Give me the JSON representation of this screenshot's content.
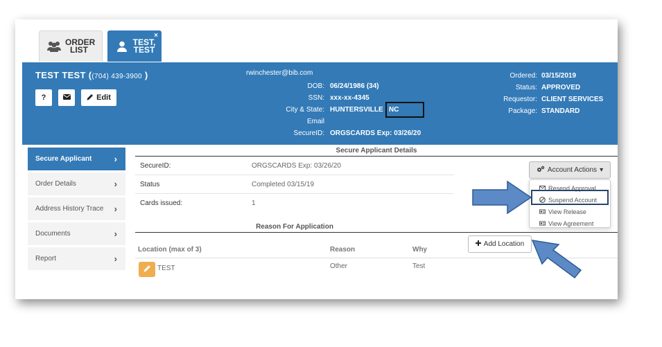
{
  "tabs": [
    {
      "label_line1": "ORDER",
      "label_line2": "LIST",
      "icon": "users-icon"
    },
    {
      "label_line1": "TEST,",
      "label_line2": "TEST",
      "icon": "user-icon",
      "close": "×"
    }
  ],
  "header": {
    "name": "TEST TEST",
    "phone_open": "(",
    "phone": "(704) 439-3900",
    "phone_close": ")",
    "buttons": {
      "help": "?",
      "email_icon": "envelope-icon",
      "edit": "Edit"
    },
    "email": "rwinchester@bib.com",
    "middle": [
      {
        "label": "DOB:",
        "value": "06/24/1986 (34)"
      },
      {
        "label": "SSN:",
        "value": "xxx-xx-4345"
      },
      {
        "label": "City & State:",
        "value": "HUNTERSVILLE , NC"
      },
      {
        "label": "Email",
        "value": ""
      },
      {
        "label": "SecureID:",
        "value": "ORGSCARDS Exp: 03/26/20"
      }
    ],
    "right": [
      {
        "label": "Ordered:",
        "value": "03/15/2019"
      },
      {
        "label": "Status:",
        "value": "APPROVED"
      },
      {
        "label": "Requestor:",
        "value": "CLIENT SERVICES"
      },
      {
        "label": "Package:",
        "value": "STANDARD"
      }
    ]
  },
  "sidebar": {
    "items": [
      {
        "label": "Secure Applicant",
        "chevron": "›",
        "active": true
      },
      {
        "label": "Order Details",
        "chevron": "›"
      },
      {
        "label": "Address History Trace",
        "chevron": "›"
      },
      {
        "label": "Documents",
        "chevron": "›"
      },
      {
        "label": "Report",
        "chevron": "›"
      }
    ]
  },
  "details": {
    "title": "Secure Applicant Details",
    "rows": [
      {
        "label": "SecureID:",
        "value": "ORGSCARDS Exp: 03/26/20"
      },
      {
        "label": "Status",
        "value": "Completed 03/15/19"
      },
      {
        "label": "Cards issued:",
        "value": "1"
      }
    ]
  },
  "account_actions": {
    "label": "Account Actions",
    "caret": "▾",
    "menu": [
      {
        "label": "Resend Approval",
        "icon": "envelope-icon"
      },
      {
        "label": "Suspend Account",
        "icon": "ban-icon"
      },
      {
        "label": "View Release",
        "icon": "id-card-icon"
      },
      {
        "label": "View Agreement",
        "icon": "id-card-icon"
      }
    ]
  },
  "reason": {
    "title": "Reason For Application",
    "add_button": "Add Location",
    "add_icon": "plus-icon",
    "columns": [
      "Location (max of 3)",
      "Reason",
      "Why"
    ],
    "rows": [
      {
        "location": "TEST",
        "reason": "Other",
        "why": "Test"
      }
    ]
  },
  "colors": {
    "primary": "#337ab7",
    "warning": "#f0ad4e",
    "arrow": "#5b8ac6"
  }
}
